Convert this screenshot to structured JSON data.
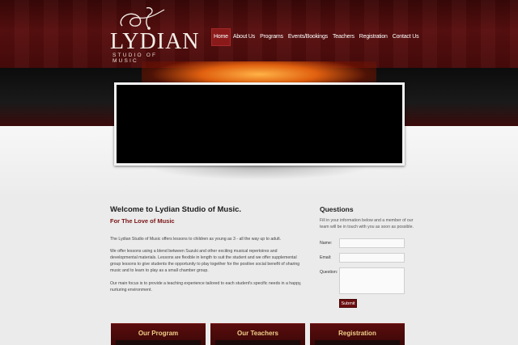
{
  "logo": {
    "name": "LYDIAN",
    "tagline": "STUDIO OF MUSIC"
  },
  "nav": {
    "items": [
      {
        "label": "Home",
        "active": true
      },
      {
        "label": "About Us",
        "active": false
      },
      {
        "label": "Programs",
        "active": false
      },
      {
        "label": "Events/Bookings",
        "active": false
      },
      {
        "label": "Teachers",
        "active": false
      },
      {
        "label": "Registration",
        "active": false
      },
      {
        "label": "Contact Us",
        "active": false
      }
    ]
  },
  "welcome": {
    "title": "Welcome to Lydian Studio of Music.",
    "subtitle": "For The Love of Music",
    "paragraphs": [
      "The Lydian Studio of Music offers lessons to children as young as 3 - all the way up to adult.",
      "We offer lessons using a blend between Suzuki and other exciting musical repertoires and developmental materials. Lessons are flexible in length to suit the student and we offer supplemental group lessons to give students the opportunity to play together for the positive social benefit of sharing music and to learn to play as a small chamber group.",
      "Our main focus is to provide a teaching experience tailored to each student's specific needs in a happy, nurturing environment."
    ]
  },
  "questions": {
    "title": "Questions",
    "intro": "Fill in your information below and a member of our team will be in touch with you as soon as possible.",
    "name_label": "Name:",
    "email_label": "Email:",
    "question_label": "Question:",
    "submit_label": "Submit"
  },
  "tabs": [
    "Our Program",
    "Our Teachers",
    "Registration"
  ],
  "colors": {
    "brand": "#5a0f0f",
    "accent": "#f0cf8a",
    "submit": "#6b0f0f"
  }
}
